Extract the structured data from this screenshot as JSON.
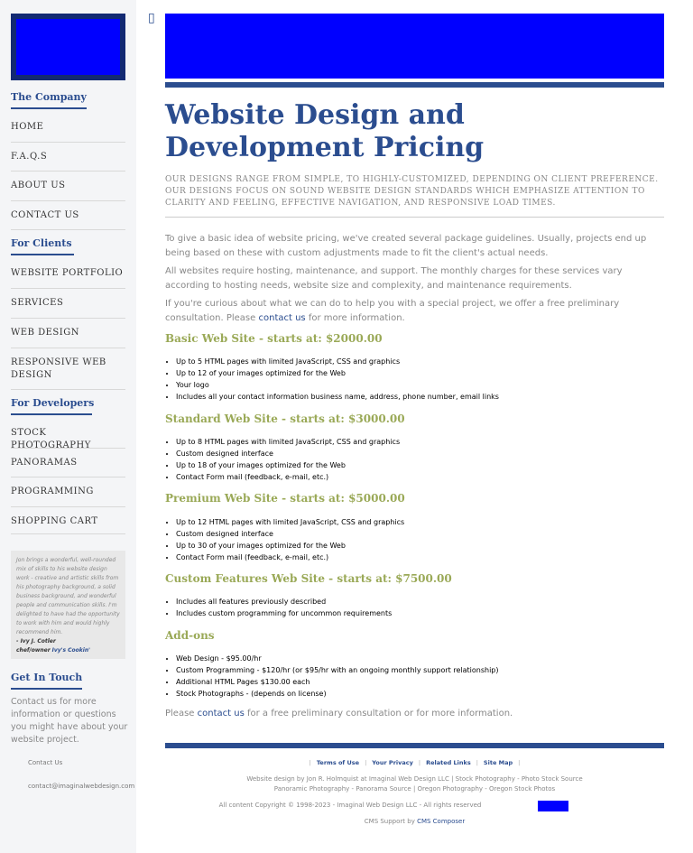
{
  "sidebar": {
    "section_company": "The Company",
    "company_items": [
      "HOME",
      "F.A.Q.S",
      "ABOUT US",
      "CONTACT US"
    ],
    "section_clients": "For Clients",
    "client_items": [
      "WEBSITE PORTFOLIO",
      "SERVICES",
      "WEB DESIGN",
      "RESPONSIVE WEB DESIGN"
    ],
    "section_developers": "For Developers",
    "developer_items": [
      "STOCK PHOTOGRAPHY",
      "PANORAMAS",
      "PROGRAMMING",
      "SHOPPING CART"
    ],
    "testimonial": {
      "quote": "Jon brings a wonderful, well-rounded mix of skills to his website design work - creative and artistic skills from his photography background, a solid business background, and wonderful people and communication skills. I'm delighted to have had the opportunity to work with him and would highly recommend him.",
      "author": "- Ivy J. Cotler",
      "role": "chef/owner",
      "company": "Ivy's Cookin'"
    },
    "section_touch": "Get In Touch",
    "touch_text": "Contact us for more information or questions you might have about your website project.",
    "contact_link": "Contact Us",
    "email": "contact@imaginalwebdesign.com"
  },
  "main": {
    "title": "Website Design and Development Pricing",
    "intro": "OUR DESIGNS RANGE FROM SIMPLE, TO HIGHLY-CUSTOMIZED, DEPENDING ON CLIENT PREFERENCE. OUR DESIGNS FOCUS ON SOUND WEBSITE DESIGN STANDARDS WHICH EMPHASIZE ATTENTION TO CLARITY AND FEELING, EFFECTIVE NAVIGATION, AND RESPONSIVE LOAD TIMES.",
    "para1": "To give a basic idea of website pricing, we've created several package guidelines. Usually, projects end up being based on these with custom adjustments made to fit the client's actual needs.",
    "para2": "All websites require hosting, maintenance, and support. The monthly charges for these services vary according to hosting needs, website size and complexity, and maintenance requirements.",
    "para3_before": "If you're curious about what we can do to help you with a special project, we offer a free preliminary consultation. Please ",
    "para3_link": "contact us",
    "para3_after": " for more information.",
    "packages": [
      {
        "title": "Basic Web Site - starts at: $2000.00",
        "items": [
          "Up to 5 HTML pages with limited JavaScript, CSS and graphics",
          "Up to 12 of your images optimized for the Web",
          "Your logo",
          "Includes all your contact information business name, address, phone number, email links"
        ]
      },
      {
        "title": "Standard Web Site - starts at: $3000.00",
        "items": [
          "Up to 8 HTML pages with limited JavaScript, CSS and graphics",
          "Custom designed interface",
          "Up to 18 of your images optimized for the Web",
          "Contact Form mail (feedback, e-mail, etc.)"
        ]
      },
      {
        "title": "Premium Web Site - starts at: $5000.00",
        "items": [
          "Up to 12 HTML pages with limited JavaScript, CSS and graphics",
          "Custom designed interface",
          "Up to 30 of your images optimized for the Web",
          "Contact Form mail (feedback, e-mail, etc.)"
        ]
      },
      {
        "title": "Custom Features Web Site - starts at: $7500.00",
        "items": [
          "Includes all features previously described",
          "Includes custom programming for uncommon requirements"
        ]
      },
      {
        "title": "Add-ons",
        "items": [
          "Web Design - $95.00/hr",
          "Custom Programming - $120/hr (or $95/hr with an ongoing monthly support relationship)",
          "Additional HTML Pages $130.00 each",
          "Stock Photographs - (depends on license)"
        ]
      }
    ],
    "closing_before": "Please ",
    "closing_link": "contact us",
    "closing_after": " for a free preliminary consultation or for more information."
  },
  "footer": {
    "links": [
      "Terms of Use",
      "Your Privacy",
      "Related Links",
      "Site Map"
    ],
    "line1": "Website design by Jon R. Holmquist at Imaginal Web Design LLC  | Stock Photography - Photo Stock Source",
    "line2": "Panoramic Photography - Panorama Source  | Oregon Photography - Oregon Stock Photos",
    "line3": "All content Copyright © 1998-2023 - Imaginal Web Design LLC - All rights reserved",
    "support_label": "CMS Support by ",
    "support_link": "CMS Composer"
  },
  "colors": {
    "brand": "#2b4d8f",
    "accent": "#9aa957",
    "banner": "#0000ff"
  }
}
